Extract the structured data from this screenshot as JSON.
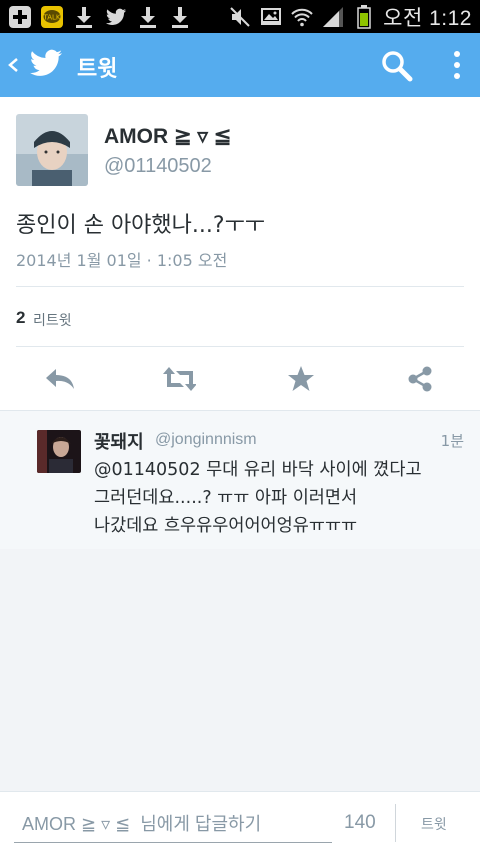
{
  "status_bar": {
    "time": "오전 1:12",
    "icons": [
      "plus-icon",
      "kakaotalk-icon",
      "download-icon",
      "twitter-icon",
      "download-icon",
      "download-icon",
      "mute-icon",
      "gallery-icon",
      "wifi-icon",
      "signal-icon",
      "battery-icon"
    ],
    "kakao_label": "TALK"
  },
  "action_bar": {
    "title": "트윗",
    "color": "#55acee"
  },
  "tweet": {
    "author_name": "AMOR ≧ ▿ ≦",
    "author_handle": "@01140502",
    "text": "종인이 손 아야했나...?ㅜㅜ",
    "timestamp": "2014년 1월 01일 · 1:05 오전",
    "retweet_count": "2",
    "retweet_label": "리트윗",
    "actions": [
      "reply-icon",
      "retweet-icon",
      "favorite-icon",
      "share-icon"
    ]
  },
  "reply": {
    "name": "꽃돼지",
    "handle": "@jonginnnism",
    "time": "1분",
    "lines": [
      "@01140502 무대 유리 바닥 사이에 꼈다고",
      "그러던데요.....? ㅠㅠ 아파 이러면서",
      "나갔데요 흐우유우어어어엉유ㅠㅠㅠ"
    ]
  },
  "compose": {
    "placeholder": "AMOR ≧ ▿ ≦  님에게 답글하기",
    "char_count": "140",
    "send_label": "트윗"
  }
}
